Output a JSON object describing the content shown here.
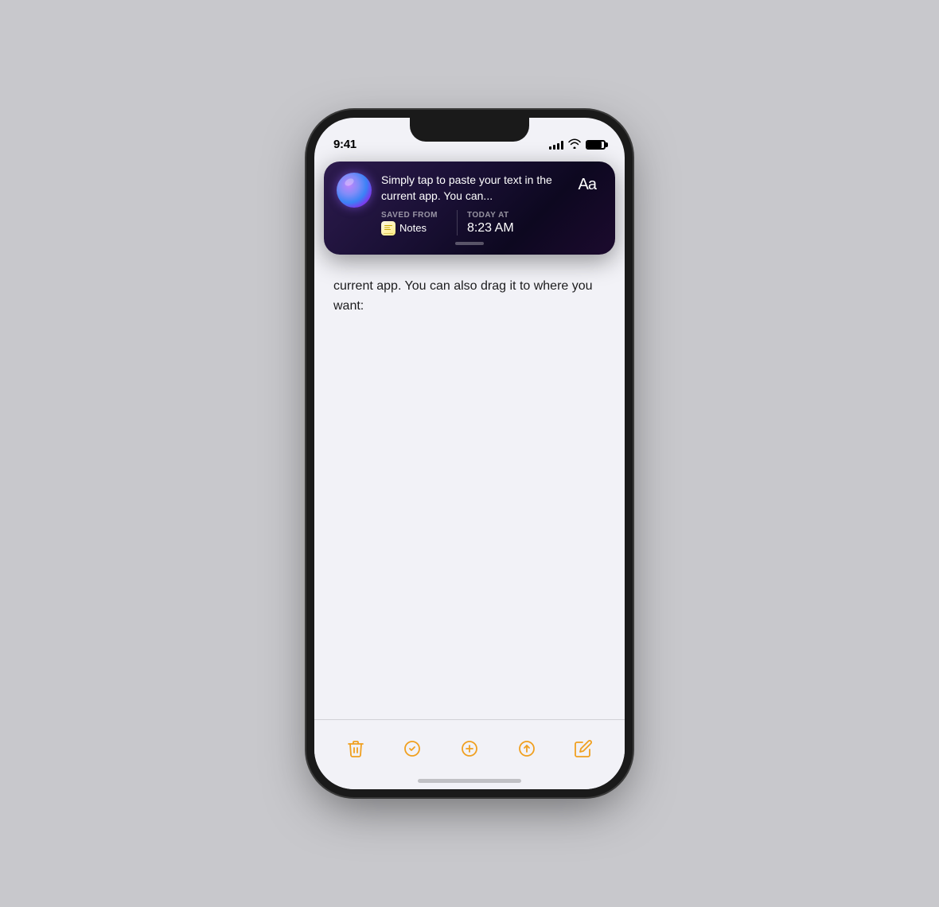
{
  "status_bar": {
    "time": "9:41"
  },
  "siri_banner": {
    "main_text": "Simply tap to paste your text in the current app. You can...",
    "saved_from_label": "SAVED FROM",
    "source_name": "Notes",
    "today_at_label": "TODAY AT",
    "time": "8:23 AM",
    "aa_button": "Aa"
  },
  "notes": {
    "body_text": "current app. You can also drag it to where you want:"
  },
  "toolbar": {
    "delete_label": "Delete",
    "check_label": "Check",
    "add_label": "Add",
    "share_label": "Share",
    "compose_label": "Compose"
  }
}
